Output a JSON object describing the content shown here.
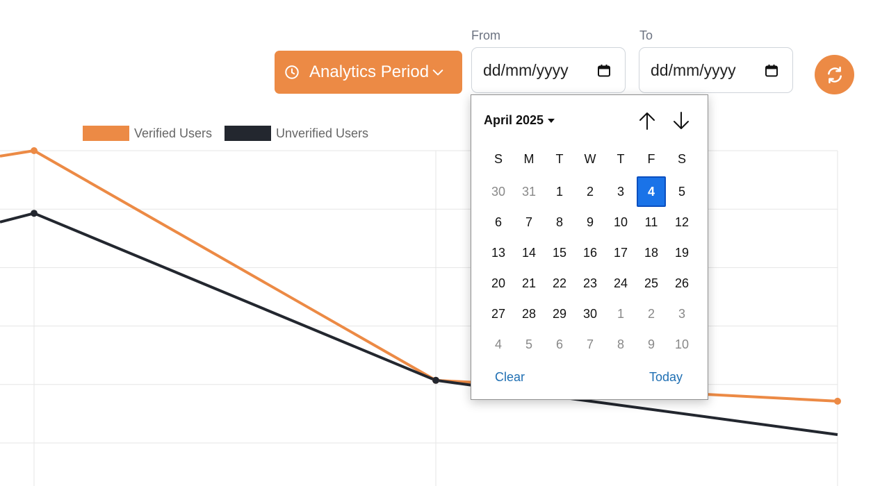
{
  "colors": {
    "accent": "#EC8A45",
    "verified_line": "#EC8A45",
    "unverified_line": "#23272F",
    "grid": "#e5e5e5",
    "selected_day": "#1a73e8",
    "link": "#1f6fb3"
  },
  "header": {
    "period_button_label": "Analytics Period",
    "period_icon": "clock-icon",
    "period_chevron": "chevron-down-icon",
    "refresh_icon": "refresh-icon",
    "from_label": "From",
    "to_label": "To",
    "from_value": "dd/mm/yyyy",
    "to_value": "dd/mm/yyyy",
    "calendar_icon": "calendar-icon"
  },
  "datepicker": {
    "month_label": "April 2025",
    "prev_icon": "arrow-up-icon",
    "next_icon": "arrow-down-icon",
    "weekdays": [
      "S",
      "M",
      "T",
      "W",
      "T",
      "F",
      "S"
    ],
    "weeks": [
      [
        {
          "d": "30",
          "other": true
        },
        {
          "d": "31",
          "other": true
        },
        {
          "d": "1"
        },
        {
          "d": "2"
        },
        {
          "d": "3"
        },
        {
          "d": "4",
          "selected": true
        },
        {
          "d": "5"
        }
      ],
      [
        {
          "d": "6"
        },
        {
          "d": "7"
        },
        {
          "d": "8"
        },
        {
          "d": "9"
        },
        {
          "d": "10"
        },
        {
          "d": "11"
        },
        {
          "d": "12"
        }
      ],
      [
        {
          "d": "13"
        },
        {
          "d": "14"
        },
        {
          "d": "15"
        },
        {
          "d": "16"
        },
        {
          "d": "17"
        },
        {
          "d": "18"
        },
        {
          "d": "19"
        }
      ],
      [
        {
          "d": "20"
        },
        {
          "d": "21"
        },
        {
          "d": "22"
        },
        {
          "d": "23"
        },
        {
          "d": "24"
        },
        {
          "d": "25"
        },
        {
          "d": "26"
        }
      ],
      [
        {
          "d": "27"
        },
        {
          "d": "28"
        },
        {
          "d": "29"
        },
        {
          "d": "30"
        },
        {
          "d": "1",
          "other": true
        },
        {
          "d": "2",
          "other": true
        },
        {
          "d": "3",
          "other": true
        }
      ],
      [
        {
          "d": "4",
          "other": true
        },
        {
          "d": "5",
          "other": true
        },
        {
          "d": "6",
          "other": true
        },
        {
          "d": "7",
          "other": true
        },
        {
          "d": "8",
          "other": true
        },
        {
          "d": "9",
          "other": true
        },
        {
          "d": "10",
          "other": true
        }
      ]
    ],
    "clear_label": "Clear",
    "today_label": "Today"
  },
  "chart_data": {
    "type": "line",
    "title": "",
    "xlabel": "",
    "ylabel": "",
    "grid": true,
    "legend_position": "top-left",
    "x": [
      0,
      1,
      2
    ],
    "series": [
      {
        "name": "Verified Users",
        "values": [
          100,
          45,
          40
        ]
      },
      {
        "name": "Unverified Users",
        "values": [
          85,
          45,
          32
        ]
      }
    ],
    "ylim": [
      30,
      100
    ]
  }
}
